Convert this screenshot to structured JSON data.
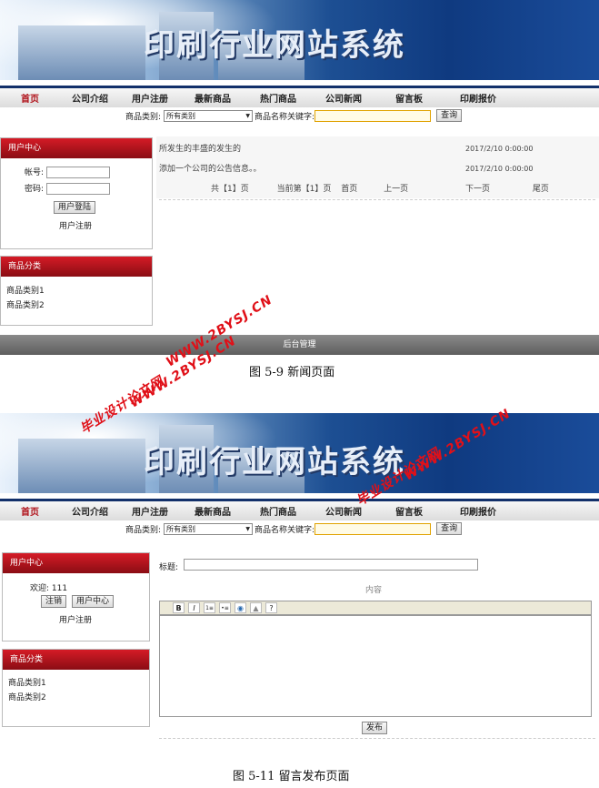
{
  "top": {
    "banner_title": "印刷行业网站系统",
    "nav": [
      "首页",
      "公司介绍",
      "用户注册",
      "最新商品",
      "热门商品",
      "公司新闻",
      "留言板",
      "印刷报价"
    ],
    "search": {
      "category_label": "商品类别:",
      "category_value": "所有类别",
      "keyword_label": "商品名称关键字:",
      "button": "查询"
    },
    "user_panel": {
      "title": "用户中心",
      "account_label": "帐号:",
      "password_label": "密码:",
      "login_button": "用户登陆",
      "register_link": "用户注册"
    },
    "category_panel": {
      "title": "商品分类",
      "items": [
        "商品类别1",
        "商品类别2"
      ]
    },
    "news": [
      {
        "title": "所发生的丰盛的发生的",
        "date": "2017/2/10 0:00:00"
      },
      {
        "title": "添加一个公司的公告信息。。",
        "date": "2017/2/10 0:00:00"
      }
    ],
    "pager": {
      "total": "共【1】页",
      "current": "当前第【1】页",
      "first": "首页",
      "prev": "上一页",
      "next": "下一页",
      "last": "尾页"
    },
    "footer": "后台管理",
    "caption": "图 5-9 新闻页面"
  },
  "bottom": {
    "banner_title": "印刷行业网站系统",
    "nav": [
      "首页",
      "公司介绍",
      "用户注册",
      "最新商品",
      "热门商品",
      "公司新闻",
      "留言板",
      "印刷报价"
    ],
    "search": {
      "category_label": "商品类别:",
      "category_value": "所有类别",
      "keyword_label": "商品名称关键字:",
      "button": "查询"
    },
    "user_panel": {
      "title": "用户中心",
      "welcome": "欢迎: 111",
      "logout_button": "注销",
      "center_button": "用户中心",
      "register_link": "用户注册"
    },
    "category_panel": {
      "title": "商品分类",
      "items": [
        "商品类别1",
        "商品类别2"
      ]
    },
    "form": {
      "title_label": "标题:",
      "content_label": "内容",
      "toolbar": [
        "B",
        "I",
        "1≡",
        "•≡",
        "◉",
        "▲",
        "?"
      ],
      "submit": "发布"
    },
    "caption": "图 5-11 留言发布页面"
  },
  "watermarks": [
    "WWW.2BYSJ.CN",
    "毕业设计论文网",
    "WWW.2BYSJ.CN",
    "毕业设计论文网",
    "WWW.2BYSJ.CN"
  ],
  "colors": {
    "nav_border": "#12306a",
    "panel_header": "#c0141d",
    "footer_bar": "#707070",
    "watermark": "#e01018"
  }
}
